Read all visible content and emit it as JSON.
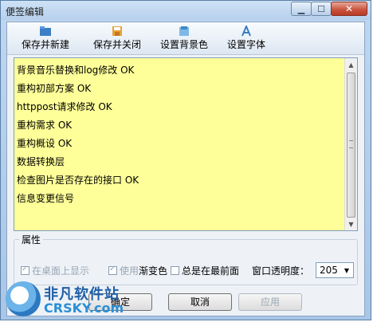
{
  "window": {
    "title": "便签编辑",
    "minimize_glyph": "▁",
    "maximize_glyph": "☐",
    "close_glyph": "✕"
  },
  "toolbar": {
    "items": [
      {
        "label": "保存并新建",
        "icon": "folder-icon"
      },
      {
        "label": "保存并关闭",
        "icon": "save-icon"
      },
      {
        "label": "设置背景色",
        "icon": "palette-icon"
      },
      {
        "label": "设置字体",
        "icon": "font-icon"
      }
    ]
  },
  "note": {
    "background": "#ffff99",
    "lines": [
      "背景音乐替换和log修改 OK",
      "重构初部方案 OK",
      "httppost请求修改 OK",
      "重构需求 OK",
      "重构概设 OK",
      "数据转换层",
      "检查图片是否存在的接口 OK",
      "信息变更信号"
    ]
  },
  "properties": {
    "legend": "属性",
    "show_on_desktop": {
      "label": "在桌面上显示",
      "checked": true,
      "enabled": false
    },
    "use_gradient": {
      "label_prefix": "使用",
      "label_suffix": "渐变色",
      "checked": true,
      "enabled": false
    },
    "always_on_top": {
      "label": "总是在最前面",
      "checked": false,
      "enabled": true
    },
    "transparency_label": "窗口透明度：",
    "transparency_value": "205"
  },
  "buttons": {
    "ok": "确定",
    "cancel": "取消",
    "apply": "应用"
  },
  "watermark": {
    "line1": "非凡软件站",
    "line2": "CRSKY.com"
  }
}
